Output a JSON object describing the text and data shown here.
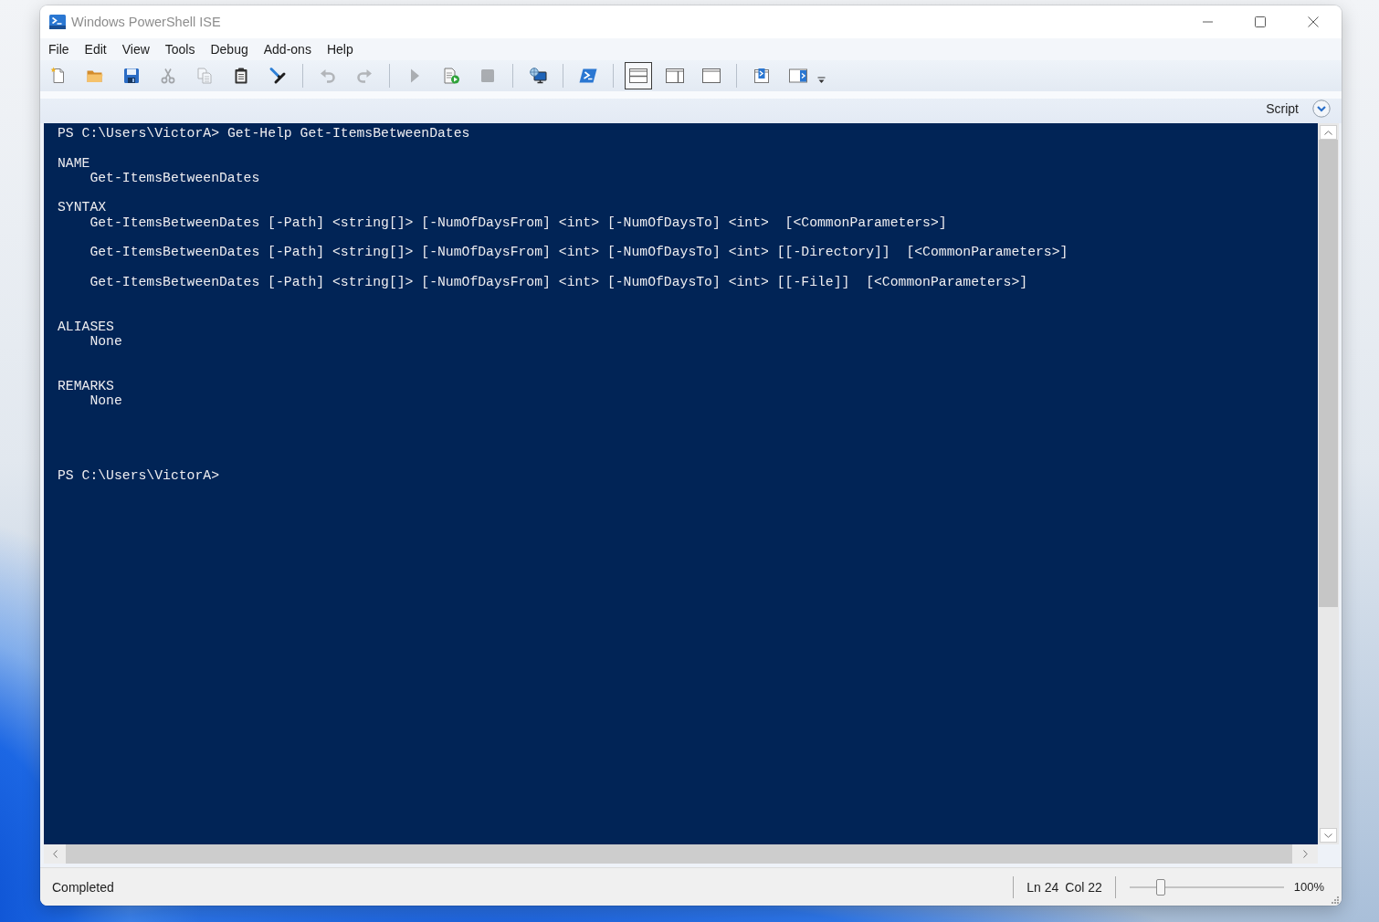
{
  "window": {
    "title": "Windows PowerShell ISE"
  },
  "menu": [
    "File",
    "Edit",
    "View",
    "Tools",
    "Debug",
    "Add-ons",
    "Help"
  ],
  "toolbar": {
    "groups": [
      [
        {
          "disabled": false
        },
        {
          "disabled": false
        },
        {
          "disabled": false
        },
        {
          "disabled": true
        },
        {
          "disabled": true
        },
        {
          "disabled": false
        },
        {
          "disabled": false
        }
      ],
      [
        {
          "disabled": true
        },
        {
          "disabled": true
        }
      ],
      [
        {
          "disabled": true
        },
        {
          "disabled": false
        },
        {
          "disabled": true
        }
      ],
      [
        {
          "disabled": false
        }
      ],
      [
        {
          "disabled": false
        }
      ],
      [
        {
          "disabled": false,
          "selected": true
        },
        {
          "disabled": false,
          "selected": false
        },
        {
          "disabled": false,
          "selected": false
        }
      ],
      [
        {
          "disabled": false
        },
        {
          "disabled": false
        }
      ]
    ]
  },
  "script_toggle": {
    "label": "Script"
  },
  "console": {
    "lines": [
      {
        "kind": "text",
        "text": "PS C:\\Users\\VictorA> Get-Help Get-ItemsBetweenDates"
      },
      {
        "kind": "blank"
      },
      {
        "kind": "text",
        "text": "NAME"
      },
      {
        "kind": "indented",
        "text": "Get-ItemsBetweenDates"
      },
      {
        "kind": "blank"
      },
      {
        "kind": "text",
        "text": "SYNTAX"
      },
      {
        "kind": "indented",
        "text": "Get-ItemsBetweenDates [-Path] <string[]> [-NumOfDaysFrom] <int> [-NumOfDaysTo] <int>  [<CommonParameters>]"
      },
      {
        "kind": "blank"
      },
      {
        "kind": "indented",
        "text": "Get-ItemsBetweenDates [-Path] <string[]> [-NumOfDaysFrom] <int> [-NumOfDaysTo] <int> [[-Directory]]  [<CommonParameters>]"
      },
      {
        "kind": "blank"
      },
      {
        "kind": "indented",
        "text": "Get-ItemsBetweenDates [-Path] <string[]> [-NumOfDaysFrom] <int> [-NumOfDaysTo] <int> [[-File]]  [<CommonParameters>]"
      },
      {
        "kind": "blank"
      },
      {
        "kind": "blank"
      },
      {
        "kind": "text",
        "text": "ALIASES"
      },
      {
        "kind": "indented",
        "text": "None"
      },
      {
        "kind": "blank"
      },
      {
        "kind": "blank"
      },
      {
        "kind": "text",
        "text": "REMARKS"
      },
      {
        "kind": "indented",
        "text": "None"
      },
      {
        "kind": "blank"
      },
      {
        "kind": "blank"
      },
      {
        "kind": "blank"
      },
      {
        "kind": "blank"
      },
      {
        "kind": "text",
        "text": "PS C:\\Users\\VictorA>"
      }
    ]
  },
  "status_bar": {
    "status": "Completed",
    "line": "Ln 24",
    "column": "Col 22",
    "zoom": {
      "level": 0.2,
      "reading": "100%"
    }
  }
}
